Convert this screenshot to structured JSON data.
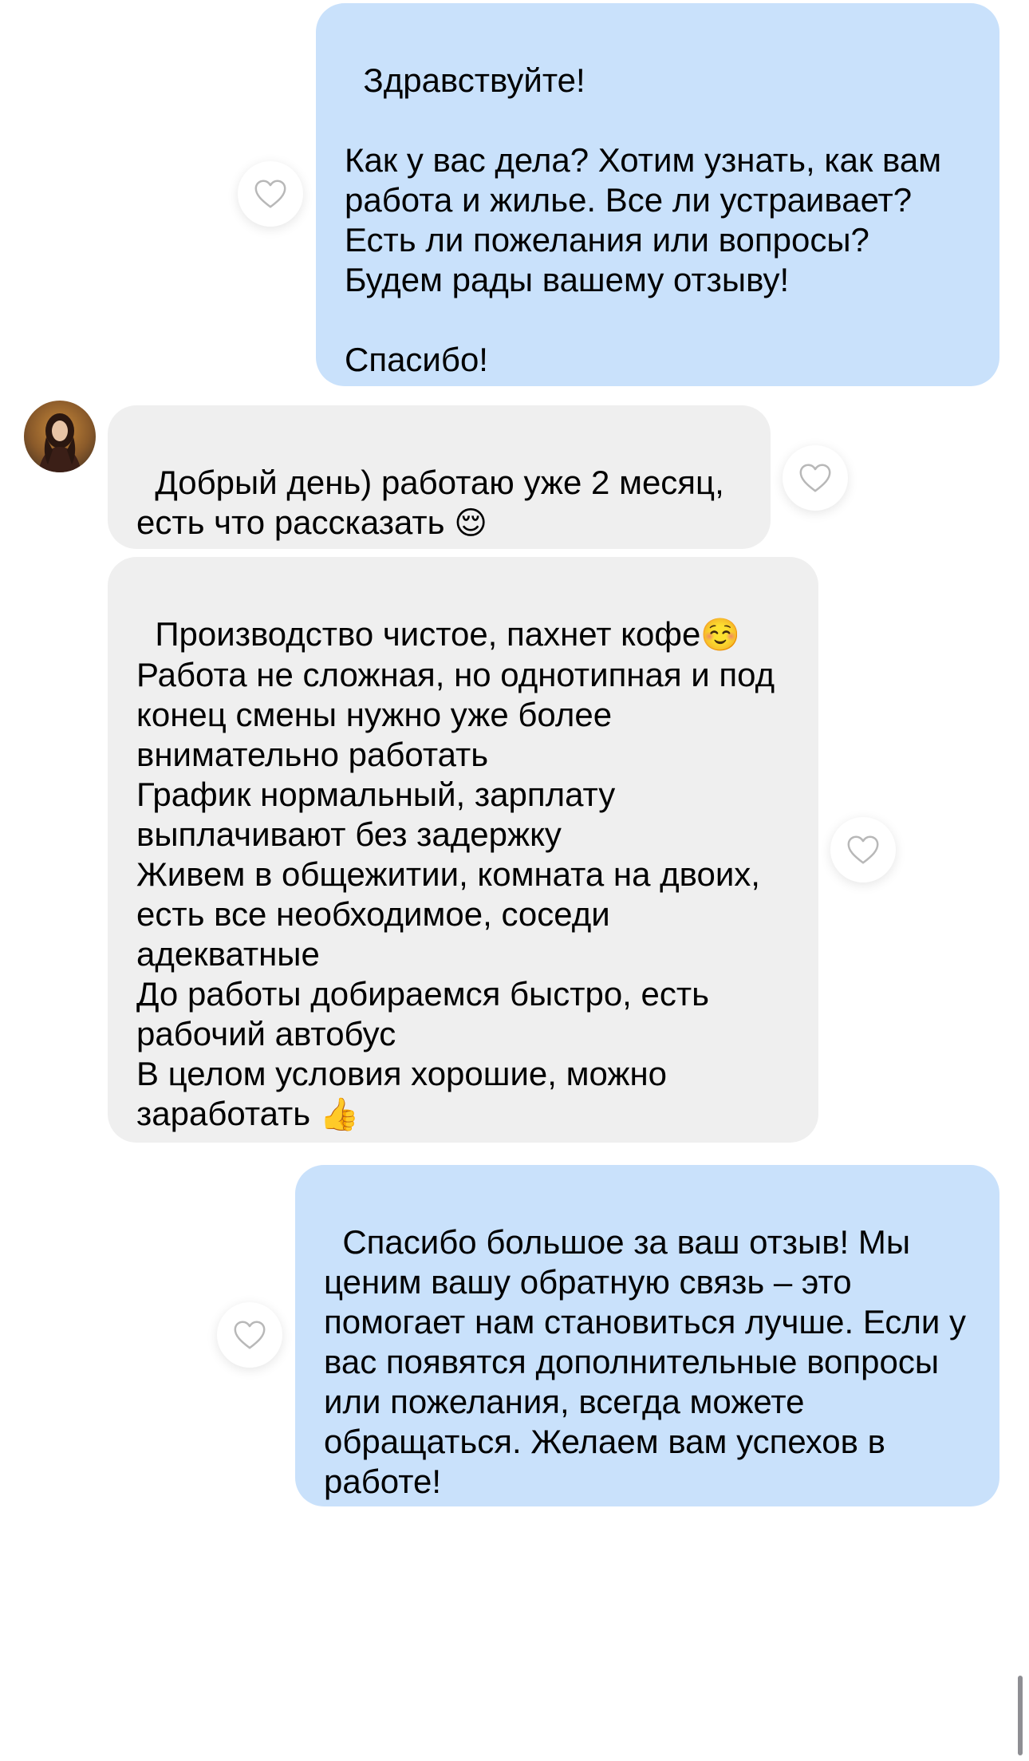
{
  "messages": [
    {
      "direction": "outgoing",
      "text": "Здравствуйте!\n\nКак у вас дела? Хотим узнать, как вам работа и жилье. Все ли устраивает? Есть ли пожелания или вопросы?\nБудем рады вашему отзыву!\n\nСпасибо!"
    },
    {
      "direction": "incoming",
      "text": "Добрый день) работаю уже 2 месяц, есть что рассказать",
      "emoji": "😌"
    },
    {
      "direction": "incoming",
      "text_1": "Производство чистое, пахнет кофе",
      "emoji_1": "☺️",
      "text_2": "\nРабота не сложная, но однотипная и под конец смены нужно уже более внимательно работать\nГрафик нормальный, зарплату выплачивают без задержку\nЖивем в общежитии, комната на двоих, есть все необходимое, соседи адекватные\nДо работы добираемся быстро, есть рабочий автобус\nВ целом условия хорошие, можно заработать ",
      "emoji_2": "👍"
    },
    {
      "direction": "outgoing",
      "text": "Спасибо большое за ваш отзыв! Мы ценим вашу обратную связь – это помогает нам становиться лучше. Если у вас появятся дополнительные вопросы или пожелания, всегда можете обращаться. Желаем вам успехов в работе!"
    }
  ],
  "icons": {
    "like": "heart-outline-icon",
    "avatar": "user-avatar-photo"
  },
  "colors": {
    "outgoing_bubble": "#c9e1fb",
    "incoming_bubble": "#efefef",
    "background": "#ffffff",
    "heart_stroke": "#b8b8b8"
  }
}
